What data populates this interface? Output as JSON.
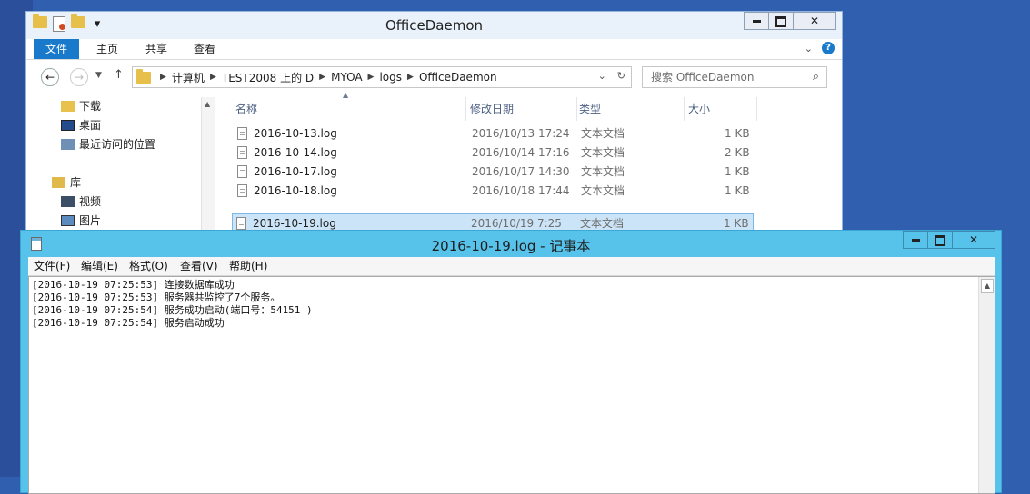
{
  "explorer": {
    "title": "OfficeDaemon",
    "ribbon_tabs": [
      "文件",
      "主页",
      "共享",
      "查看"
    ],
    "breadcrumb": [
      "计算机",
      "TEST2008 上的 D",
      "MYOA",
      "logs",
      "OfficeDaemon"
    ],
    "search_placeholder": "搜索 OfficeDaemon",
    "tree": [
      {
        "label": "下载",
        "icon": "downloads-folder-icon"
      },
      {
        "label": "桌面",
        "icon": "desktop-icon"
      },
      {
        "label": "最近访问的位置",
        "icon": "recent-places-icon"
      },
      {
        "label": "库",
        "icon": "library-icon"
      },
      {
        "label": "视频",
        "icon": "video-library-icon"
      },
      {
        "label": "图片",
        "icon": "pictures-library-icon"
      }
    ],
    "columns": [
      "名称",
      "修改日期",
      "类型",
      "大小"
    ],
    "files": [
      {
        "name": "2016-10-13.log",
        "modified": "2016/10/13 17:24",
        "type": "文本文档",
        "size": "1 KB"
      },
      {
        "name": "2016-10-14.log",
        "modified": "2016/10/14 17:16",
        "type": "文本文档",
        "size": "2 KB"
      },
      {
        "name": "2016-10-17.log",
        "modified": "2016/10/17 14:30",
        "type": "文本文档",
        "size": "1 KB"
      },
      {
        "name": "2016-10-18.log",
        "modified": "2016/10/18 17:44",
        "type": "文本文档",
        "size": "1 KB"
      },
      {
        "name": "2016-10-19.log",
        "modified": "2016/10/19 7:25",
        "type": "文本文档",
        "size": "1 KB"
      }
    ],
    "selected_file": "2016-10-19.log"
  },
  "notepad": {
    "title": "2016-10-19.log - 记事本",
    "menu": [
      "文件(F)",
      "编辑(E)",
      "格式(O)",
      "查看(V)",
      "帮助(H)"
    ],
    "lines": [
      "[2016-10-19 07:25:53] 连接数据库成功",
      "[2016-10-19 07:25:53] 服务器共监控了7个服务。",
      "[2016-10-19 07:25:54] 服务成功启动(端口号：54151 )",
      "[2016-10-19 07:25:54] 服务启动成功"
    ]
  },
  "colors": {
    "desktop": "#2f5fae",
    "ribbon_active": "#1979ca",
    "selection": "#cce4f7",
    "notepad_frame": "#57c3eb"
  }
}
